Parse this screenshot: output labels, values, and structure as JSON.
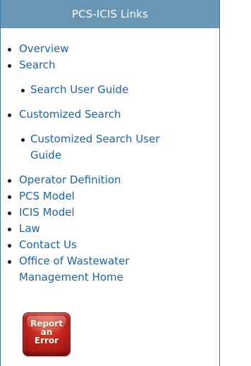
{
  "header": {
    "title": "PCS-ICIS Links"
  },
  "links": [
    {
      "label": "Overview"
    },
    {
      "label": "Search",
      "children": [
        {
          "label": "Search User Guide"
        }
      ]
    },
    {
      "label": "Customized Search",
      "children": [
        {
          "label": "Customized Search User Guide"
        }
      ]
    },
    {
      "label": "Operator Definition"
    },
    {
      "label": "PCS Model"
    },
    {
      "label": "ICIS Model"
    },
    {
      "label": "Law"
    },
    {
      "label": "Contact Us"
    },
    {
      "label": "Office of Wastewater Management Home"
    }
  ],
  "report_button": {
    "label": "Report\nan\nError"
  },
  "colors": {
    "header_bg": "#6a96b6",
    "link": "#1b63ad",
    "border": "#3f7aa3"
  }
}
